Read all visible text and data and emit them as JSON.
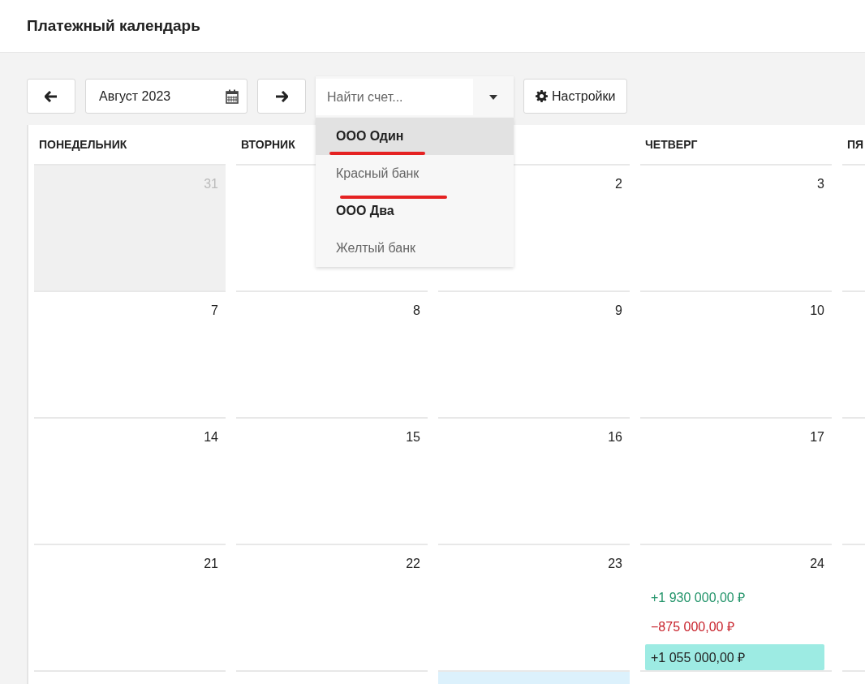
{
  "page": {
    "title": "Платежный календарь"
  },
  "toolbar": {
    "period": "Август 2023",
    "search": {
      "placeholder": "Найти счет...",
      "options": [
        {
          "label": "ООО Один",
          "kind": "group",
          "selected": true,
          "annotated": true
        },
        {
          "label": "Красный банк",
          "kind": "option",
          "selected": false,
          "annotated": true
        },
        {
          "label": "ООО Два",
          "kind": "group",
          "selected": false,
          "annotated": false
        },
        {
          "label": "Желтый банк",
          "kind": "option",
          "selected": false,
          "annotated": false
        }
      ]
    },
    "settings": "Настройки"
  },
  "calendar": {
    "columns": [
      {
        "label": "ПОНЕДЕЛЬНИК"
      },
      {
        "label": "ВТОРНИК"
      },
      {},
      {
        "label": "ЧЕТВЕРГ"
      },
      {
        "label": "ПЯ"
      }
    ],
    "weeks": [
      {
        "days": [
          {
            "day": "31",
            "outside": true,
            "today": false
          },
          {
            "outside": false,
            "today": false
          },
          {
            "day": "2",
            "outside": false,
            "today": false
          },
          {
            "day": "3",
            "outside": false,
            "today": false
          },
          {
            "outside": false,
            "today": false
          }
        ]
      },
      {
        "days": [
          {
            "day": "7",
            "outside": false,
            "today": false
          },
          {
            "day": "8",
            "outside": false,
            "today": false
          },
          {
            "day": "9",
            "outside": false,
            "today": false
          },
          {
            "day": "10",
            "outside": false,
            "today": false
          },
          {
            "outside": false,
            "today": false
          }
        ]
      },
      {
        "days": [
          {
            "day": "14",
            "outside": false,
            "today": false
          },
          {
            "day": "15",
            "outside": false,
            "today": false
          },
          {
            "day": "16",
            "outside": false,
            "today": false
          },
          {
            "day": "17",
            "outside": false,
            "today": false
          },
          {
            "outside": false,
            "today": false
          }
        ]
      },
      {
        "days": [
          {
            "day": "21",
            "outside": false,
            "today": false
          },
          {
            "day": "22",
            "outside": false,
            "today": false
          },
          {
            "day": "23",
            "outside": false,
            "today": false
          },
          {
            "day": "24",
            "outside": false,
            "today": false,
            "entries": [
              {
                "amount": "+1 930 000,00 ₽",
                "kind": "income"
              },
              {
                "amount": "−875 000,00 ₽",
                "kind": "expense"
              },
              {
                "amount": "+1 055 000,00 ₽",
                "kind": "total"
              }
            ]
          },
          {
            "outside": false,
            "today": false
          }
        ]
      },
      {
        "days": [
          {
            "outside": false,
            "today": false
          },
          {
            "outside": false,
            "today": false
          },
          {
            "outside": false,
            "today": true
          },
          {
            "outside": false,
            "today": false
          },
          {
            "outside": false,
            "today": false
          }
        ]
      }
    ]
  }
}
